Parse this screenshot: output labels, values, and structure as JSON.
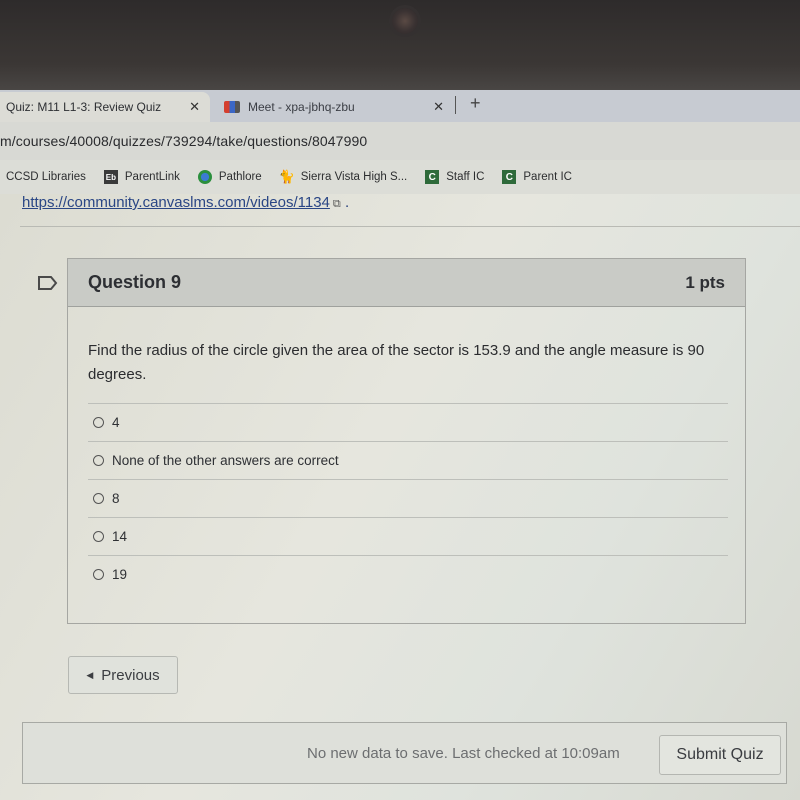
{
  "browser": {
    "tabs": [
      {
        "title": "Quiz: M11 L1-3: Review Quiz",
        "active": true,
        "close_icon": "close-icon"
      },
      {
        "title": "Meet - xpa-jbhq-zbu",
        "active": false,
        "close_icon": "close-icon"
      }
    ],
    "new_tab_label": "+",
    "url": "m/courses/40008/quizzes/739294/take/questions/8047990",
    "bookmarks": [
      {
        "label": "CCSD Libraries",
        "icon": "none"
      },
      {
        "label": "ParentLink",
        "icon": "eb-icon",
        "icon_text": "Eb"
      },
      {
        "label": "Pathlore",
        "icon": "pathlore-icon"
      },
      {
        "label": "Sierra Vista High S...",
        "icon": "cat-icon"
      },
      {
        "label": "Staff IC",
        "icon": "c-icon",
        "icon_text": "C"
      },
      {
        "label": "Parent IC",
        "icon": "c-icon",
        "icon_text": "C"
      }
    ]
  },
  "page": {
    "link_text": "https://community.canvaslms.com/videos/1134",
    "link_suffix": ".",
    "question": {
      "title": "Question 9",
      "points": "1 pts",
      "text": "Find the radius of the circle given the area of the sector is 153.9 and the angle measure is 90 degrees.",
      "answers": [
        "4",
        "None of the other answers are correct",
        "8",
        "14",
        "19"
      ],
      "selected": null
    },
    "previous_label": "Previous",
    "save_status": "No new data to save. Last checked at 10:09am",
    "submit_label": "Submit Quiz"
  }
}
